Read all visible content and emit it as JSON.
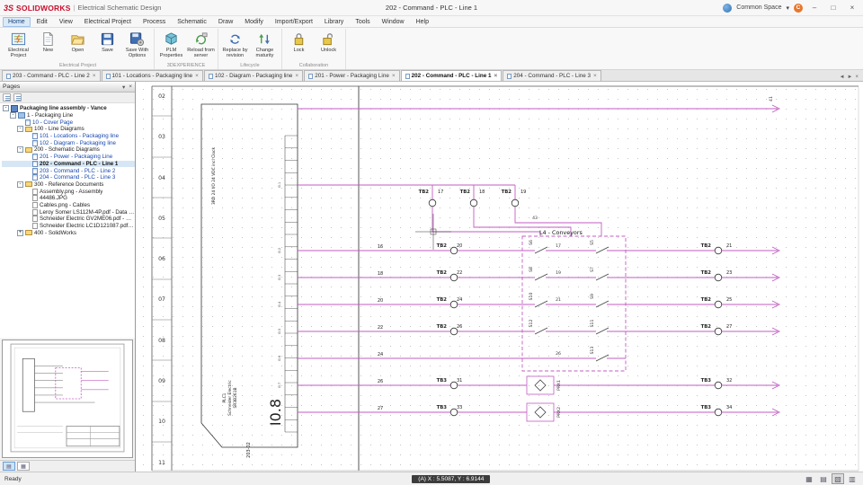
{
  "window": {
    "logo_mark": "3S",
    "logo_brand": "SOLIDWORKS",
    "logo_div": "|",
    "logo_app": "Electrical Schematic Design",
    "title": "202 - Command - PLC - Line 1",
    "space": "Common Space",
    "caret": "▾",
    "avatar": "C",
    "minimize": "–",
    "maximize": "□",
    "close": "×"
  },
  "menu": {
    "items": [
      "Home",
      "Edit",
      "View",
      "Electrical Project",
      "Process",
      "Schematic",
      "Draw",
      "Modify",
      "Import/Export",
      "Library",
      "Tools",
      "Window",
      "Help"
    ]
  },
  "ribbon": {
    "buttons": [
      "Electrical Project",
      "New",
      "Open",
      "Save",
      "Save With Options",
      "PLM Properties",
      "Reload from server",
      "Replace by revision",
      "Change maturity",
      "Lock",
      "Unlock"
    ],
    "groups": [
      "Electrical Project",
      "3DEXPERIENCE",
      "Lifecycle",
      "Collaboration"
    ]
  },
  "tabs": {
    "close_glyph": "×",
    "scroll_left": "◄",
    "scroll_right": "►",
    "close_all": "×",
    "items": [
      {
        "label": "203 - Command - PLC - Line 2"
      },
      {
        "label": "101 - Locations - Packaging line"
      },
      {
        "label": "102 - Diagram - Packaging line"
      },
      {
        "label": "201 - Power - Packaging Line"
      },
      {
        "label": "202 - Command - PLC - Line 1"
      },
      {
        "label": "204 - Command - PLC - Line 3"
      }
    ]
  },
  "pages": {
    "title": "Pages",
    "caret_glyph": "▾",
    "close_glyph": "×",
    "tree": [
      {
        "label": "Packaging line assembly - Vance",
        "expand": "-"
      },
      {
        "label": "1 - Packaging Line",
        "expand": "-"
      },
      {
        "label": "10 - Cover Page"
      },
      {
        "label": "100 - Line Diagrams",
        "expand": "-"
      },
      {
        "label": "101 - Locations - Packaging line"
      },
      {
        "label": "102 - Diagram - Packaging line"
      },
      {
        "label": "200 - Schematic Diagrams",
        "expand": "-"
      },
      {
        "label": "201 - Power - Packaging Line"
      },
      {
        "label": "202 - Command - PLC - Line 1"
      },
      {
        "label": "203 - Command - PLC - Line 2"
      },
      {
        "label": "204 - Command - PLC - Line 3"
      },
      {
        "label": "300 - Reference Documents",
        "expand": "-"
      },
      {
        "label": "Assembly.png - Assembly"
      },
      {
        "label": "44486.JPG"
      },
      {
        "label": "Cables.png - Cables"
      },
      {
        "label": "Leroy Somer LS112M-4P.pdf - Data sh..."
      },
      {
        "label": "Schneider Electric GV2ME06.pdf - Data..."
      },
      {
        "label": "Schneider Electric LC1D121087.pdf - D..."
      },
      {
        "label": "400 - SolidWorks",
        "expand": "+"
      }
    ]
  },
  "schematic": {
    "rows": [
      "02",
      "03",
      "04",
      "05",
      "06",
      "07",
      "08",
      "09",
      "10",
      "11"
    ],
    "plc": {
      "slot_label": "3RD 24 I/O 24 VDC incl Clock",
      "pins": [
        "I0.1",
        "I0.2",
        "I0.3",
        "I0.4",
        "I0.5",
        "I0.6",
        "I0.7",
        "I0.8"
      ],
      "name": "PLC1",
      "maker": "Schneider Electric",
      "model": "SR3B261B"
    },
    "sheet_ref": "203-02",
    "net_top": "41",
    "net_mid": "43",
    "enclosure_label": "L4 - Conveyors",
    "top_terminals": [
      {
        "name": "TB2",
        "pin": "17"
      },
      {
        "name": "TB2",
        "pin": "18"
      },
      {
        "name": "TB2",
        "pin": "19"
      }
    ],
    "left_rows": [
      {
        "wire": "16",
        "name": "TB2",
        "pin": "20"
      },
      {
        "wire": "18",
        "name": "TB2",
        "pin": "22"
      },
      {
        "wire": "20",
        "name": "TB2",
        "pin": "24"
      },
      {
        "wire": "22",
        "name": "TB2",
        "pin": "26"
      }
    ],
    "mid_wire": "24",
    "tb3_left": [
      {
        "wire": "26",
        "name": "TB3",
        "pin": "31"
      },
      {
        "wire": "27",
        "name": "TB3",
        "pin": "33"
      }
    ],
    "right_rows": [
      {
        "name": "TB2",
        "pin": "21"
      },
      {
        "name": "TB2",
        "pin": "23"
      },
      {
        "name": "TB2",
        "pin": "25"
      },
      {
        "name": "TB2",
        "pin": "27"
      }
    ],
    "tb3_right": [
      {
        "name": "TB3",
        "pin": "32"
      },
      {
        "name": "TB3",
        "pin": "34"
      }
    ],
    "coil_nums": [
      "17",
      "19",
      "21",
      "26"
    ],
    "contacts_mid": [
      "S6",
      "S8",
      "S10",
      "S12"
    ],
    "contacts_right": [
      "S5",
      "S7",
      "S9",
      "S11",
      "S13"
    ],
    "sensors": [
      "PRX1",
      "PRX2"
    ]
  },
  "statusbar": {
    "ready": "Ready",
    "coords": "(A) X : 5.5087, Y : 6.9144",
    "icons": [
      {
        "name": "table-icon",
        "glyph": "▦"
      },
      {
        "name": "grid-snap-icon",
        "glyph": "▤"
      },
      {
        "name": "selection-filter-icon",
        "glyph": "▧"
      },
      {
        "name": "layers-icon",
        "glyph": "▥"
      }
    ]
  }
}
